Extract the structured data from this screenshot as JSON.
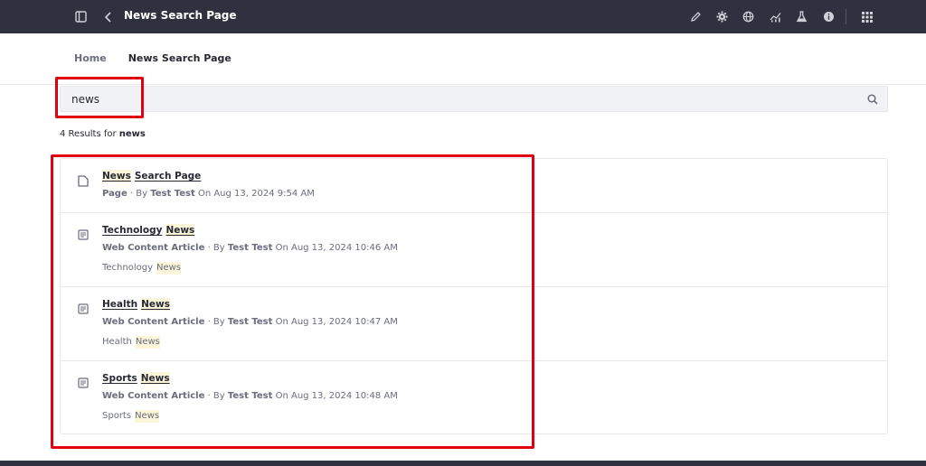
{
  "topbar": {
    "title": "News Search Page",
    "icons": [
      "sidebar-toggle-icon",
      "chevron-left-icon",
      "pencil-icon",
      "gear-icon",
      "globe-icon",
      "analytics-icon",
      "flask-icon",
      "info-icon",
      "apps-grid-icon"
    ]
  },
  "breadcrumb": {
    "home": "Home",
    "current": "News Search Page"
  },
  "search": {
    "value": "news",
    "placeholder": ""
  },
  "results": {
    "count_prefix": "4 Results for",
    "query": "news",
    "items": [
      {
        "icon": "page-icon",
        "title_words": [
          "News",
          "Search Page"
        ],
        "type": "Page",
        "by": "· By",
        "author": "Test Test",
        "date": "On Aug 13, 2024 9:54 AM",
        "tags": []
      },
      {
        "icon": "web-content-icon",
        "title_words": [
          "Technology",
          "News"
        ],
        "type": "Web Content Article",
        "by": "· By",
        "author": "Test Test",
        "date": "On Aug 13, 2024 10:46 AM",
        "tags": [
          "Technology",
          "News"
        ]
      },
      {
        "icon": "web-content-icon",
        "title_words": [
          "Health",
          "News"
        ],
        "type": "Web Content Article",
        "by": "· By",
        "author": "Test Test",
        "date": "On Aug 13, 2024 10:47 AM",
        "tags": [
          "Health",
          "News"
        ]
      },
      {
        "icon": "web-content-icon",
        "title_words": [
          "Sports",
          "News"
        ],
        "type": "Web Content Article",
        "by": "· By",
        "author": "Test Test",
        "date": "On Aug 13, 2024 10:48 AM",
        "tags": [
          "Sports",
          "News"
        ]
      }
    ]
  },
  "colors": {
    "topbar": "#30313f",
    "highlight": "#fbf6d9",
    "annotation": "#e1000f"
  }
}
